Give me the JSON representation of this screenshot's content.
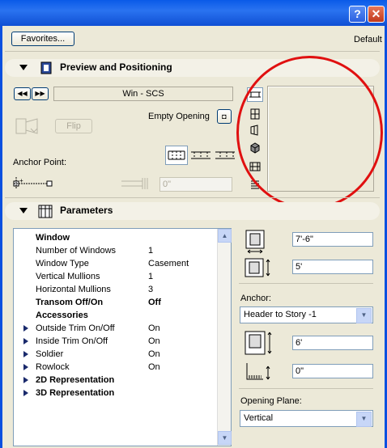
{
  "titlebar": {
    "help_label": "?",
    "close_label": "✕"
  },
  "top": {
    "favorites_label": "Favorites...",
    "default_label": "Default"
  },
  "preview": {
    "title": "Preview and Positioning",
    "name_value": "Win - SCS",
    "empty_opening_label": "Empty Opening",
    "flip_label": "Flip",
    "anchor_label": "Anchor Point:",
    "offset_value": "0\""
  },
  "parameters": {
    "title": "Parameters",
    "rows": [
      {
        "label": "Window",
        "value": "",
        "bold": true,
        "expand": false
      },
      {
        "label": "Number of Windows",
        "value": "1",
        "bold": false,
        "expand": false
      },
      {
        "label": "Window Type",
        "value": "Casement",
        "bold": false,
        "expand": false
      },
      {
        "label": "Vertical Mullions",
        "value": "1",
        "bold": false,
        "expand": false
      },
      {
        "label": "Horizontal Mullions",
        "value": "3",
        "bold": false,
        "expand": false
      },
      {
        "label": "Transom Off/On",
        "value": "Off",
        "bold": true,
        "expand": false
      },
      {
        "label": "Accessories",
        "value": "",
        "bold": true,
        "expand": false
      },
      {
        "label": "Outside Trim On/Off",
        "value": "On",
        "bold": false,
        "expand": true
      },
      {
        "label": "Inside Trim On/Off",
        "value": "On",
        "bold": false,
        "expand": true
      },
      {
        "label": "Soldier",
        "value": "On",
        "bold": false,
        "expand": true
      },
      {
        "label": "Rowlock",
        "value": "On",
        "bold": false,
        "expand": true
      },
      {
        "label": "2D Representation",
        "value": "",
        "bold": true,
        "expand": true
      },
      {
        "label": "3D Representation",
        "value": "",
        "bold": true,
        "expand": true
      }
    ]
  },
  "right": {
    "width_value": "7'-6\"",
    "height_value": "5'",
    "anchor_label": "Anchor:",
    "anchor_select": "Header to Story -1",
    "header_value": "6'",
    "sill_value": "0\"",
    "opening_plane_label": "Opening Plane:",
    "opening_plane_select": "Vertical"
  },
  "colors": {
    "annotation": "#e01010",
    "titlebar": "#0a5ae8",
    "dialog_bg": "#ece9d8"
  }
}
